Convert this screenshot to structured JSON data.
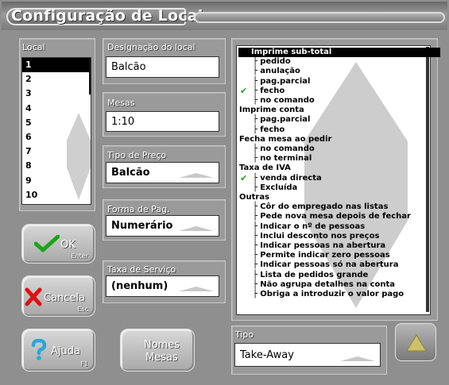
{
  "window": {
    "title": "Configuração de Locais"
  },
  "local": {
    "label": "Local",
    "items": [
      "1",
      "2",
      "3",
      "4",
      "5",
      "6",
      "7",
      "8",
      "9",
      "10"
    ],
    "selected": "1"
  },
  "fields": {
    "designacao": {
      "label": "Designação do local",
      "value": "Balcão"
    },
    "mesas": {
      "label": "Mesas",
      "value": "1:10"
    },
    "tipo_preco": {
      "label": "Tipo de Preço",
      "value": "Balcão"
    },
    "forma_pag": {
      "label": "Forma de Pag.",
      "value": "Numerário"
    },
    "taxa_servico": {
      "label": "Taxa de Serviço",
      "value": "(nenhum)"
    }
  },
  "buttons": {
    "ok": {
      "label": "OK",
      "key": "Enter"
    },
    "cancela": {
      "label": "Cancela",
      "key": "Esc"
    },
    "ajuda": {
      "label": "Ajuda",
      "key": "F1"
    },
    "nomes_mesas": {
      "label_line1": "Nomes",
      "label_line2": "Mesas"
    }
  },
  "tipo": {
    "label": "Tipo",
    "value": "Take-Away"
  },
  "options": [
    {
      "text": "Imprime sub-total",
      "level": 0,
      "selected": true
    },
    {
      "text": "pedido",
      "level": 1
    },
    {
      "text": "anulação",
      "level": 1
    },
    {
      "text": "pag.parcial",
      "level": 1
    },
    {
      "text": "fecho",
      "level": 1,
      "checked": true
    },
    {
      "text": "no comando",
      "level": 1
    },
    {
      "text": "Imprime conta",
      "level": 0
    },
    {
      "text": "pag.parcial",
      "level": 1
    },
    {
      "text": "fecho",
      "level": 1
    },
    {
      "text": "Fecha mesa ao pedir",
      "level": 0
    },
    {
      "text": "no comando",
      "level": 1
    },
    {
      "text": "no terminal",
      "level": 1
    },
    {
      "text": "Taxa de IVA",
      "level": 0
    },
    {
      "text": "venda directa",
      "level": 1,
      "checked": true
    },
    {
      "text": "Excluída",
      "level": 1
    },
    {
      "text": "Outras",
      "level": 0
    },
    {
      "text": "Côr do empregado nas listas",
      "level": 1
    },
    {
      "text": "Pede nova mesa depois de fechar",
      "level": 1
    },
    {
      "text": "Indicar o nº de pessoas",
      "level": 1
    },
    {
      "text": "Inclui desconto nos preços",
      "level": 1
    },
    {
      "text": "Indicar pessoas na abertura",
      "level": 1
    },
    {
      "text": "Permite indicar zero pessoas",
      "level": 1
    },
    {
      "text": "Indicar pessoas só na abertura",
      "level": 1
    },
    {
      "text": "Lista de pedidos grande",
      "level": 1
    },
    {
      "text": "Não agrupa detalhes na conta",
      "level": 1
    },
    {
      "text": "Obriga a introduzir o valor pago",
      "level": 1
    }
  ],
  "colors": {
    "check": "#1aa61a",
    "cancel_x": "#e01010",
    "help_q": "#2aa8d8",
    "up_arrow": "#c9c26a"
  }
}
